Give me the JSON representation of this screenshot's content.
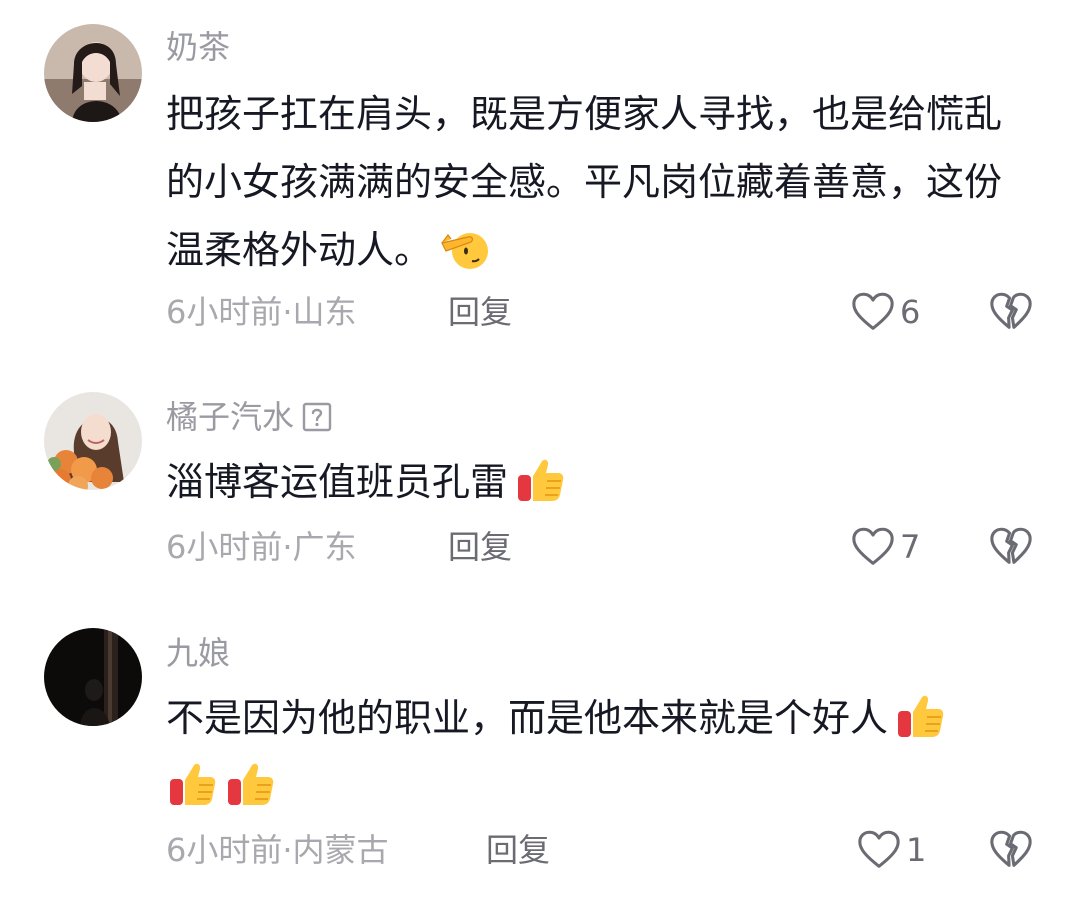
{
  "comments": [
    {
      "username": "奶茶",
      "text": "把孩子扛在肩头，既是方便家人寻找，也是给慌乱的小女孩满满的安全感。平凡岗位藏着善意，这份温柔格外动人。",
      "emojis": [
        "saluting-face-emoji"
      ],
      "time": "6小时前",
      "separator": "·",
      "location": "山东",
      "reply_label": "回复",
      "like_count": "6"
    },
    {
      "username": "橘子汽水",
      "text": "淄博客运值班员孔雷",
      "emojis": [
        "thumbs-up-emoji"
      ],
      "time": "6小时前",
      "separator": "·",
      "location": "广东",
      "reply_label": "回复",
      "like_count": "7"
    },
    {
      "username": "九娘",
      "text": "不是因为他的职业，而是他本来就是个好人",
      "emojis": [
        "thumbs-up-emoji",
        "thumbs-up-emoji",
        "thumbs-up-emoji"
      ],
      "time": "6小时前",
      "separator": "·",
      "location": "内蒙古",
      "reply_label": "回复",
      "like_count": "1"
    }
  ],
  "colors": {
    "text": "#161823",
    "secondary": "#9a9aa2",
    "icon": "#6b6b73"
  },
  "icons": {
    "like": "heart-outline-icon",
    "dislike": "broken-heart-icon",
    "unknown_badge": "question-box-icon"
  }
}
